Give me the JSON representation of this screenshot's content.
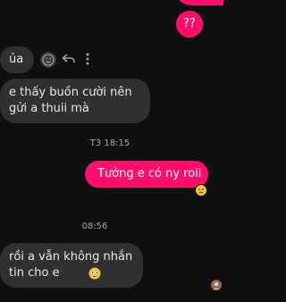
{
  "messages": [
    {
      "id": "m1",
      "side": "out",
      "text": "??"
    },
    {
      "id": "m2",
      "side": "in",
      "text": "ủa"
    },
    {
      "id": "m3",
      "side": "in",
      "text": "e thấy buồn cười nên gửi a thuii mà"
    },
    {
      "id": "m4",
      "side": "out",
      "text": "Tưởng e có ny roii"
    },
    {
      "id": "m5",
      "side": "in",
      "text": "rồi a vẫn không nhắn tin cho e"
    }
  ],
  "timestamps": {
    "t1": "T3 18:15",
    "t2": "08:56"
  },
  "reactions": {
    "m4": "sad-emoji",
    "m5": "flushed-emoji"
  },
  "colors": {
    "outgoing": "#ff0f6b",
    "incoming": "#303030",
    "background": "#0f0f0f"
  }
}
